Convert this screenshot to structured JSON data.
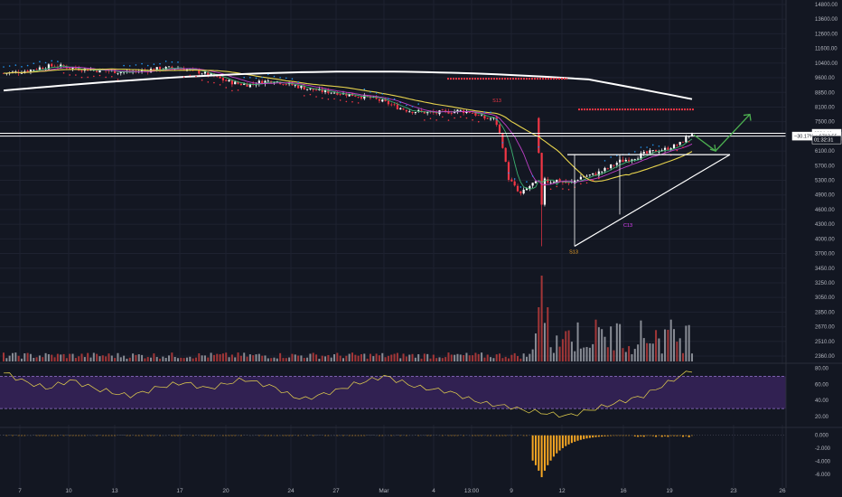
{
  "chart_data": [
    {
      "type": "candlestick",
      "title": "",
      "price_ticks": [
        "14800.00",
        "13600.00",
        "12600.00",
        "11600.00",
        "10400.00",
        "9600.00",
        "8850.00",
        "8100.00",
        "7500.00",
        "6700.00",
        "6100.00",
        "5700.00",
        "5300.00",
        "4900.00",
        "4600.00",
        "4300.00",
        "4000.00",
        "3700.00",
        "3450.00",
        "3250.00",
        "3050.00",
        "2850.00",
        "2670.00",
        "2510.00",
        "2360.00"
      ],
      "x_ticks": [
        "7",
        "10",
        "13",
        "17",
        "20",
        "24",
        "27",
        "Mar",
        "4",
        "13:00",
        "9",
        "12",
        "16",
        "19",
        "23",
        "26"
      ],
      "ylim": [
        2300,
        15200
      ],
      "price_labels": [
        {
          "text": "6864.41",
          "value": 6864,
          "bg": "#ffffff",
          "fg": "#131722"
        },
        {
          "text": "−30.17% ↑ 6713.55",
          "value": 6713,
          "bg": "#ffffff",
          "fg": "#131722"
        },
        {
          "text": "01:32:31",
          "value": 6560,
          "bg": "#131722",
          "fg": "#ffffff"
        }
      ],
      "annotations": [
        {
          "text": "S13",
          "color": "#f5a623"
        },
        {
          "text": "C13",
          "color": "#e040fb"
        },
        {
          "text": "S13",
          "color": "#f23645"
        }
      ],
      "series": [
        {
          "name": "SMA white",
          "color": "#ffffff"
        },
        {
          "name": "SMA yellow",
          "color": "#e8d44d"
        },
        {
          "name": "SMA magenta",
          "color": "#c040c8"
        },
        {
          "name": "SMA green",
          "color": "#3cb371"
        }
      ],
      "candles_anchor_close": [
        9850,
        9900,
        10000,
        10150,
        10250,
        10200,
        10100,
        10050,
        10000,
        9950,
        9900,
        9950,
        10050,
        10100,
        10150,
        10050,
        9900,
        9700,
        9450,
        9300,
        9250,
        9400,
        9450,
        9300,
        9150,
        9000,
        8900,
        8850,
        8750,
        8650,
        8550,
        8350,
        8100,
        7950,
        7900,
        7850,
        7900,
        7950,
        7900,
        7650,
        7600,
        5400,
        4900,
        5200,
        5250,
        5300,
        5200,
        5400,
        5450,
        5600,
        5800,
        5900,
        6000,
        6100,
        6200,
        6400,
        6864
      ],
      "resistance_lines": [
        6864,
        6713
      ],
      "triangle": {
        "top": 6000,
        "apex_value": 6000,
        "low": 3850
      },
      "projection": {
        "down_to": 6100,
        "up_to": 7800
      }
    },
    {
      "type": "bar",
      "title": "",
      "description_axis": "volume",
      "y_ticks": [],
      "spike_index": 44,
      "base": 2360
    },
    {
      "type": "line",
      "title": "",
      "y_ticks": [
        "80.00",
        "60.00",
        "40.00",
        "20.00"
      ],
      "ylim": [
        10,
        85
      ],
      "bands": [
        70,
        30
      ],
      "values": [
        74,
        72,
        68,
        65,
        62,
        60,
        58,
        55,
        57,
        60,
        62,
        65,
        63,
        60,
        58,
        55,
        53,
        52,
        50,
        48,
        47,
        46,
        48,
        50,
        52,
        55,
        57,
        58,
        60,
        61,
        62,
        60,
        58,
        56,
        55,
        57,
        59,
        61,
        63,
        65,
        66,
        64,
        62,
        60,
        58,
        56,
        52,
        48,
        45,
        43,
        42,
        44,
        46,
        48,
        50,
        52,
        55,
        57,
        60,
        62,
        64,
        66,
        68,
        70,
        68,
        65,
        63,
        60,
        58,
        56,
        55,
        54,
        53,
        52,
        50,
        48,
        45,
        42,
        40,
        38,
        36,
        35,
        34,
        33,
        32,
        30,
        28,
        27,
        26,
        25,
        24,
        23,
        22,
        21,
        22,
        24,
        26,
        28,
        30,
        32,
        34,
        36,
        38,
        40,
        42,
        44,
        46,
        50,
        54,
        58,
        62,
        66,
        70,
        74,
        78
      ]
    },
    {
      "type": "bar",
      "title": "",
      "y_ticks": [
        "0.000",
        "-2.000",
        "-4.000",
        "-6.000"
      ],
      "ylim": [
        -7,
        0.8
      ]
    }
  ]
}
